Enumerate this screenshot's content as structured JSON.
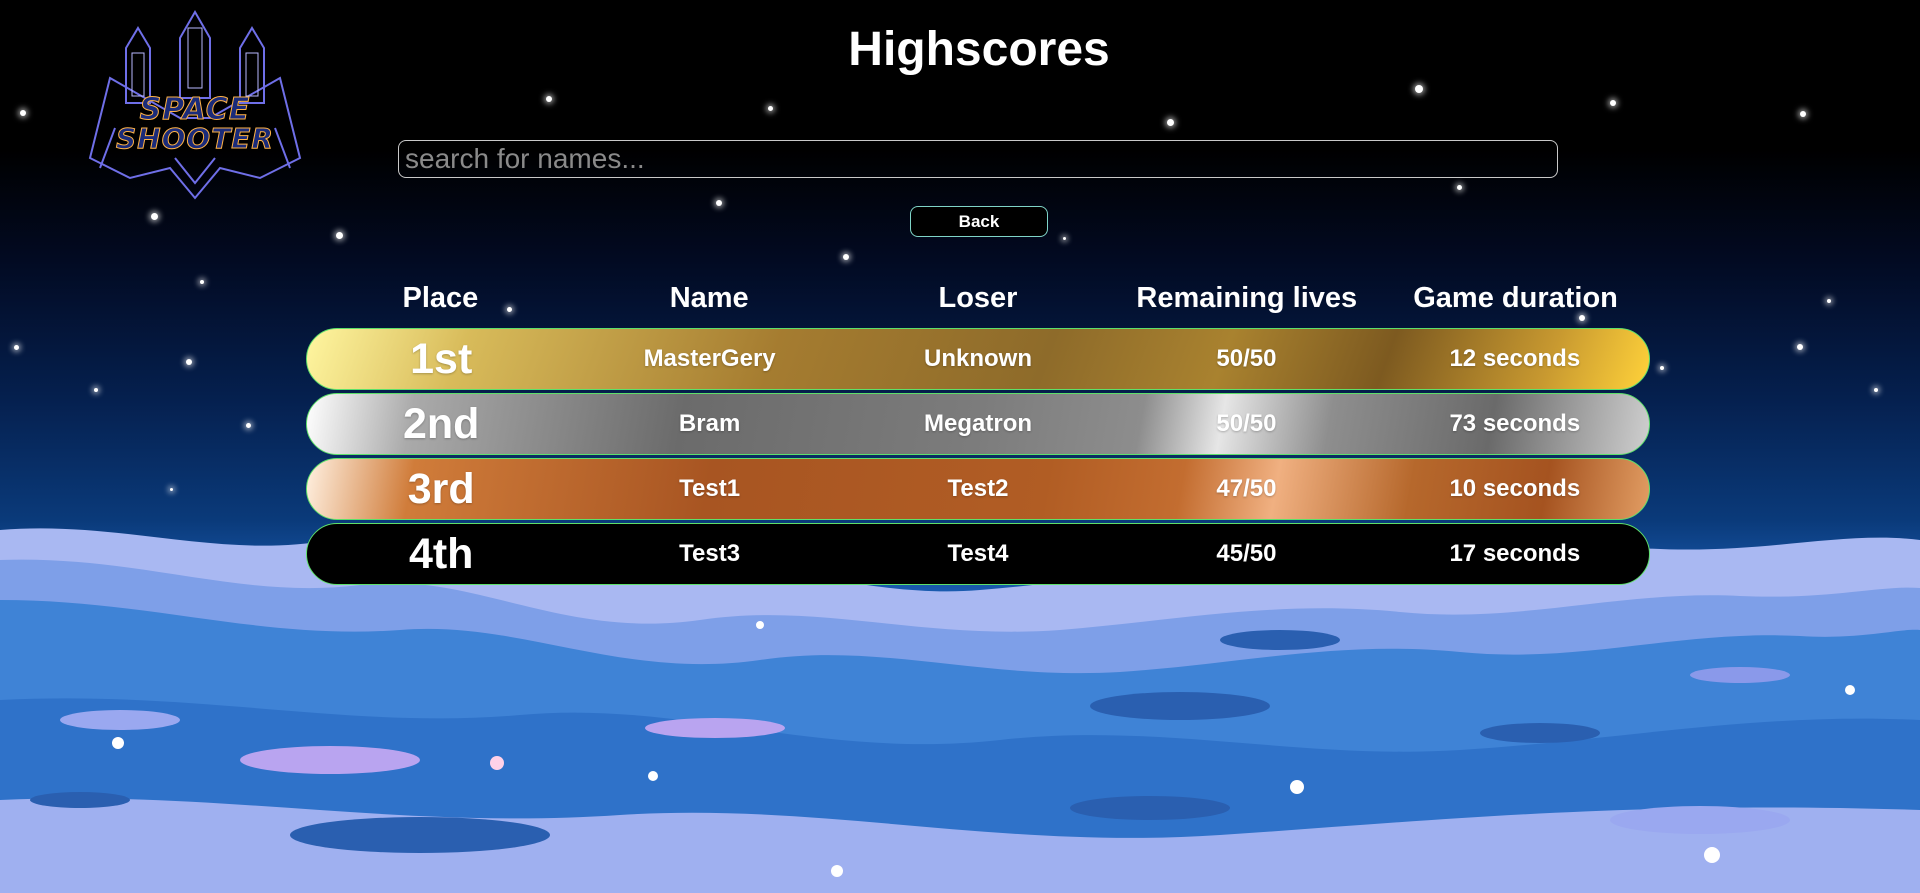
{
  "logo": {
    "line1": "SPACE",
    "line2": "SHOOTER"
  },
  "page": {
    "title": "Highscores"
  },
  "search": {
    "placeholder": "search for names...",
    "value": ""
  },
  "back_button": {
    "label": "Back"
  },
  "table": {
    "headers": [
      "Place",
      "Name",
      "Loser",
      "Remaining lives",
      "Game duration"
    ],
    "rows": [
      {
        "place": "1st",
        "name": "MasterGery",
        "loser": "Unknown",
        "lives": "50/50",
        "duration": "12 seconds"
      },
      {
        "place": "2nd",
        "name": "Bram",
        "loser": "Megatron",
        "lives": "50/50",
        "duration": "73 seconds"
      },
      {
        "place": "3rd",
        "name": "Test1",
        "loser": "Test2",
        "lives": "47/50",
        "duration": "10 seconds"
      },
      {
        "place": "4th",
        "name": "Test3",
        "loser": "Test4",
        "lives": "45/50",
        "duration": "17 seconds"
      }
    ]
  },
  "colors": {
    "gold": "#c9a243",
    "silver": "#8a8a8a",
    "bronze": "#b05c24",
    "row_border": "#5ee06a",
    "button_border": "#7fd4c7"
  }
}
